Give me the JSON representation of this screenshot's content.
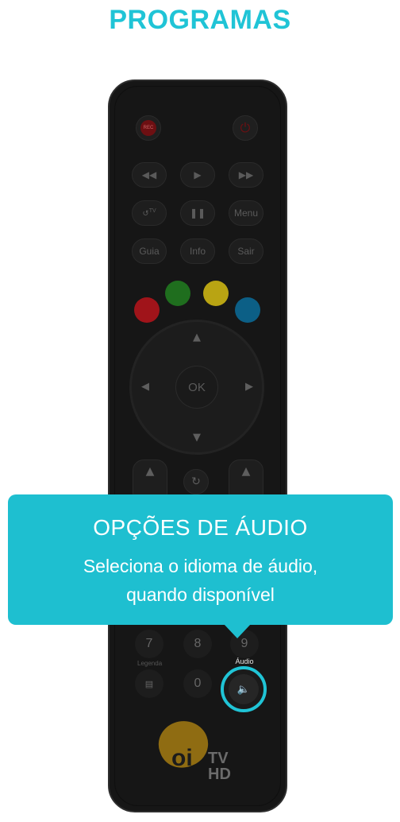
{
  "header": {
    "title": "PROGRAMAS"
  },
  "remote": {
    "rec_label": "REC",
    "guia_label": "Guia",
    "info_label": "Info",
    "sair_label": "Sair",
    "menu_label": "Menu",
    "tv_label": "TV",
    "ok_label": "OK",
    "num_7": "7",
    "num_8": "8",
    "num_9": "9",
    "num_0": "0",
    "legenda_label": "Legenda",
    "audio_label": "Áudio",
    "logo_oi": "oi",
    "logo_tv": "TV",
    "logo_hd": "HD",
    "colors": {
      "red": "#a0141a",
      "green": "#1f6e1e",
      "yellow": "#b9a413",
      "blue": "#0c5f86"
    }
  },
  "tooltip": {
    "title": "OPÇÕES DE ÁUDIO",
    "line1": "Seleciona o idioma de áudio,",
    "line2": "quando disponível"
  },
  "accent": "#20c4d6"
}
